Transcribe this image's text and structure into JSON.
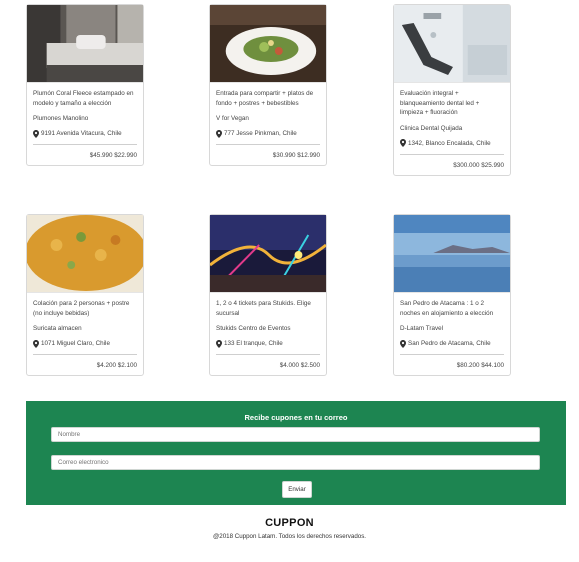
{
  "deals": [
    {
      "title": "Plumón Coral Fleece estampado en modelo y tamaño a elección",
      "merchant": "Plumones Manolino",
      "location": "9191 Avenida Vitacura, Chile",
      "price": "$45.990 $22.990",
      "image": "bedroom-photo"
    },
    {
      "title": "Entrada para compartir + platos de fondo + postres + bebestibles",
      "merchant": "V for Vegan",
      "location": "777 Jesse Pinkman, Chile",
      "price": "$30.990 $12.990",
      "image": "salad-photo"
    },
    {
      "title": "Evaluación integral + blanqueamiento dental led + limpieza + fluoración",
      "merchant": "Clinica Dental Quijada",
      "location": "1342, Blanco Encalada, Chile",
      "price": "$300.000 $25.990",
      "image": "dental-clinic-photo"
    },
    {
      "title": "Colación para 2 personas + postre (no incluye bebidas)",
      "merchant": "Suricata almacen",
      "location": "1071 Miguel Claro, Chile",
      "price": "$4.200 $2.100",
      "image": "stew-photo"
    },
    {
      "title": "1, 2 o 4 tickets para Stukids. Elige sucursal",
      "merchant": "Stukids Centro de Eventos",
      "location": "133 El tranque, Chile",
      "price": "$4.000 $2.500",
      "image": "fairground-photo"
    },
    {
      "title": "San Pedro de Atacama : 1 o 2 noches en alojamiento a elección",
      "merchant": "D-Latam Travel",
      "location": "San Pedro de Atacama, Chile",
      "price": "$80.200 $44.100",
      "image": "salt-flat-photo"
    }
  ],
  "newsletter": {
    "title": "Recibe cupones en tu correo",
    "name_placeholder": "Nombre",
    "email_placeholder": "Correo electronico",
    "submit_label": "Enviar"
  },
  "footer": {
    "brand": "CUPPON",
    "copyright": "@2018 Cuppon Latam. Todos los derechos reservados."
  },
  "colors": {
    "newsletter_bg": "#1d8551"
  },
  "icons": {
    "location": "map-marker-icon"
  }
}
